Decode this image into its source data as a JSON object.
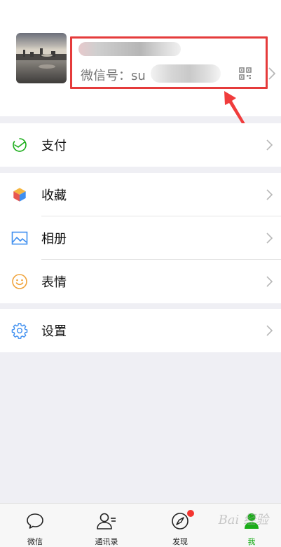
{
  "profile": {
    "wechat_id_label": "微信号：",
    "wechat_id_value_visible": "su"
  },
  "menu_groups": [
    {
      "items": [
        {
          "label": "支付",
          "icon": "wallet-icon"
        }
      ]
    },
    {
      "items": [
        {
          "label": "收藏",
          "icon": "favorites-cube-icon"
        },
        {
          "label": "相册",
          "icon": "photo-album-icon"
        },
        {
          "label": "表情",
          "icon": "smiley-icon"
        }
      ]
    },
    {
      "items": [
        {
          "label": "设置",
          "icon": "gear-icon"
        }
      ]
    }
  ],
  "tabbar": {
    "tabs": [
      {
        "label": "微信",
        "icon": "chat-bubble-icon"
      },
      {
        "label": "通讯录",
        "icon": "contacts-icon"
      },
      {
        "label": "发现",
        "icon": "compass-icon"
      },
      {
        "label": "我",
        "icon": "me-icon"
      }
    ]
  },
  "watermark": "Bai 经验",
  "colors": {
    "accent_green": "#1aad19",
    "highlight_red": "#e53b3b",
    "badge_red": "#f43530",
    "background": "#efeff4"
  }
}
